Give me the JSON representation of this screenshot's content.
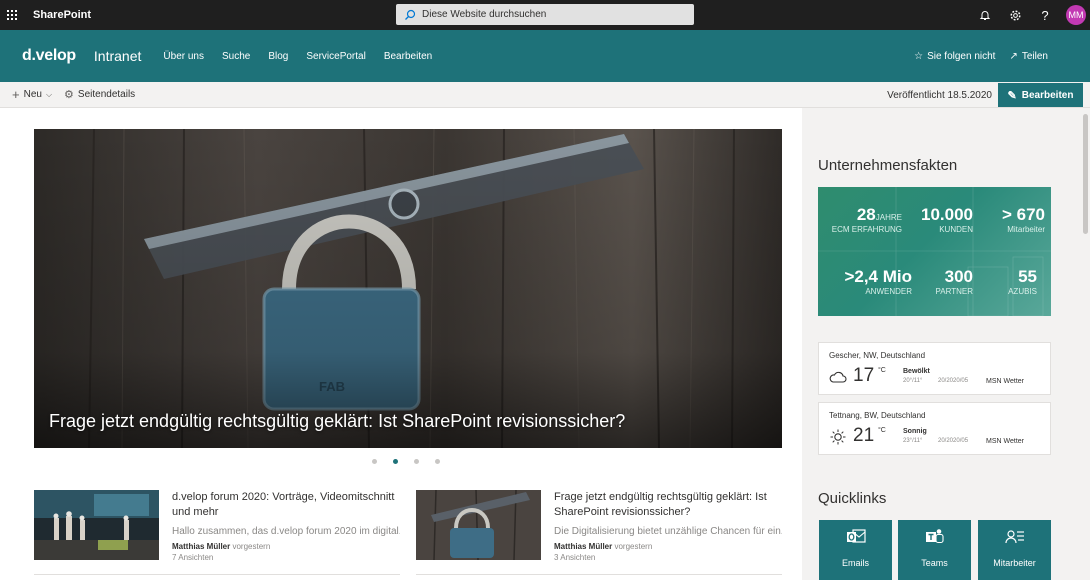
{
  "suitebar": {
    "app_name": "SharePoint",
    "search_placeholder": "Diese Website durchsuchen",
    "avatar_initials": "MM"
  },
  "header": {
    "logo": "d.velop",
    "site_title": "Intranet",
    "nav": [
      "Über uns",
      "Suche",
      "Blog",
      "ServicePortal",
      "Bearbeiten"
    ],
    "follow_label": "Sie folgen nicht",
    "share_label": "Teilen"
  },
  "commandbar": {
    "new_label": "Neu",
    "page_details_label": "Seitendetails",
    "published": "Veröffentlicht 18.5.2020",
    "edit_label": "Bearbeiten"
  },
  "hero": {
    "title": "Frage jetzt endgültig rechtsgültig geklärt: Ist SharePoint revisionssicher?",
    "slides": 4,
    "active_slide": 2
  },
  "news": [
    {
      "title": "d.velop forum 2020: Vorträge, Videomitschnitt und mehr",
      "description": "Hallo zusammen, das d.velop forum 2020 im digital...",
      "author": "Matthias Müller",
      "when": "vorgestern",
      "views": "7 Ansichten"
    },
    {
      "title": "Frage jetzt endgültig rechtsgültig geklärt: Ist SharePoint revisionssicher?",
      "description": "Die Digitalisierung bietet unzählige Chancen für ein...",
      "author": "Matthias Müller",
      "when": "vorgestern",
      "views": "3 Ansichten"
    }
  ],
  "facts": {
    "title": "Unternehmensfakten",
    "items": [
      {
        "value": "28",
        "unit": "JAHRE",
        "label": "ECM ERFAHRUNG"
      },
      {
        "value": "10.000",
        "unit": "",
        "label": "KUNDEN"
      },
      {
        "value": "> 670",
        "unit": "",
        "label": "Mitarbeiter"
      },
      {
        "value": ">2,4 Mio",
        "unit": "",
        "label": "ANWENDER"
      },
      {
        "value": "300",
        "unit": "",
        "label": "PARTNER"
      },
      {
        "value": "55",
        "unit": "",
        "label": "AZUBIS"
      }
    ]
  },
  "weather": [
    {
      "location": "Gescher, NW, Deutschland",
      "icon": "cloud-icon",
      "temp": "17",
      "unit": "°C",
      "condition": "Bewölkt",
      "range": "20°/11°",
      "date": "20/2020/05",
      "source": "MSN Wetter"
    },
    {
      "location": "Tettnang, BW, Deutschland",
      "icon": "sun-icon",
      "temp": "21",
      "unit": "°C",
      "condition": "Sonnig",
      "range": "23°/11°",
      "date": "20/2020/05",
      "source": "MSN Wetter"
    }
  ],
  "quicklinks": {
    "title": "Quicklinks",
    "items": [
      {
        "label": "Emails",
        "icon": "outlook-icon"
      },
      {
        "label": "Teams",
        "icon": "teams-icon"
      },
      {
        "label": "Mitarbeiter",
        "icon": "people-list-icon"
      }
    ]
  },
  "colors": {
    "brand": "#1e7279",
    "suitebar": "#1f1f1f",
    "avatar": "#c239b3"
  }
}
